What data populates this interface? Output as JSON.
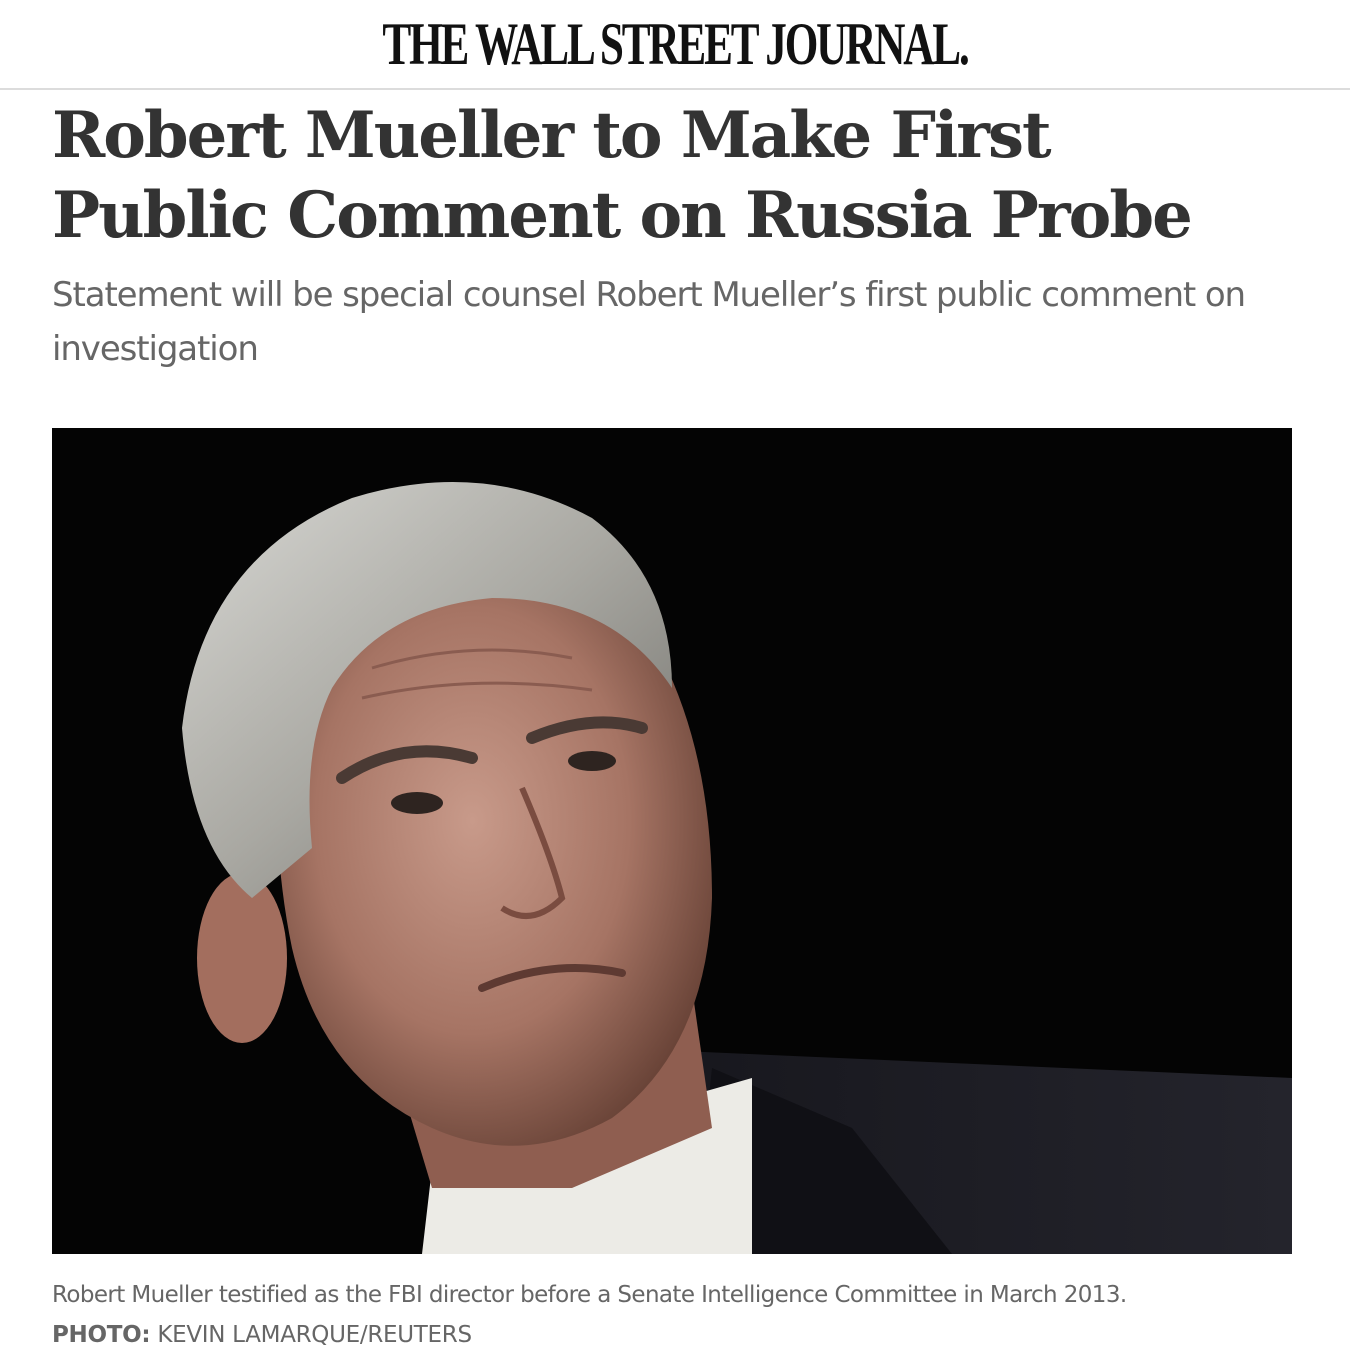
{
  "masthead": {
    "title": "THE WALL STREET JOURNAL."
  },
  "article": {
    "headline": "Robert Mueller to Make First Public Comment on Russia Probe",
    "dek": "Statement will be special counsel Robert Mueller’s first public comment on investigation",
    "caption": "Robert Mueller testified as the FBI director before a Senate Intelligence Committee in March 2013.",
    "credit_label": "PHOTO:",
    "credit_name": "KEVIN LAMARQUE/REUTERS"
  },
  "colors": {
    "headline": "#333333",
    "dek": "#666666",
    "photo_background": "#040404"
  }
}
